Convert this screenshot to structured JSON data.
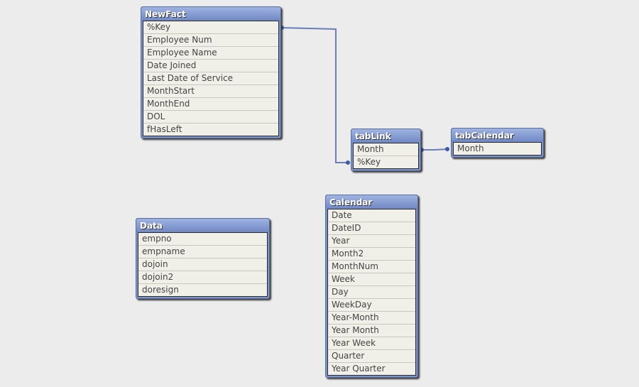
{
  "tables": [
    {
      "id": "newfact",
      "name": "NewFact",
      "fields": [
        "%Key",
        "Employee Num",
        "Employee Name",
        "Date Joined",
        "Last Date of Service",
        "MonthStart",
        "MonthEnd",
        "DOL",
        "fHasLeft"
      ]
    },
    {
      "id": "tablink",
      "name": "tabLink",
      "fields": [
        "Month",
        "%Key"
      ]
    },
    {
      "id": "tabcalendar",
      "name": "tabCalendar",
      "fields": [
        "Month"
      ]
    },
    {
      "id": "data",
      "name": "Data",
      "fields": [
        "empno",
        "empname",
        "dojoin",
        "dojoin2",
        "doresign"
      ]
    },
    {
      "id": "calendar",
      "name": "Calendar",
      "fields": [
        "Date",
        "DateID",
        "Year",
        "Month2",
        "MonthNum",
        "Week",
        "Day",
        "WeekDay",
        "Year-Month",
        "Year Month",
        "Year Week",
        "Quarter",
        "Year Quarter"
      ]
    }
  ],
  "links": [
    {
      "from": "NewFact.%Key",
      "to": "tabLink.%Key"
    },
    {
      "from": "tabLink.Month",
      "to": "tabCalendar.Month"
    }
  ],
  "colors": {
    "header": "#7b93c9",
    "link": "#6a7fb5",
    "background": "#ececec",
    "row": "#f1f0e8"
  }
}
